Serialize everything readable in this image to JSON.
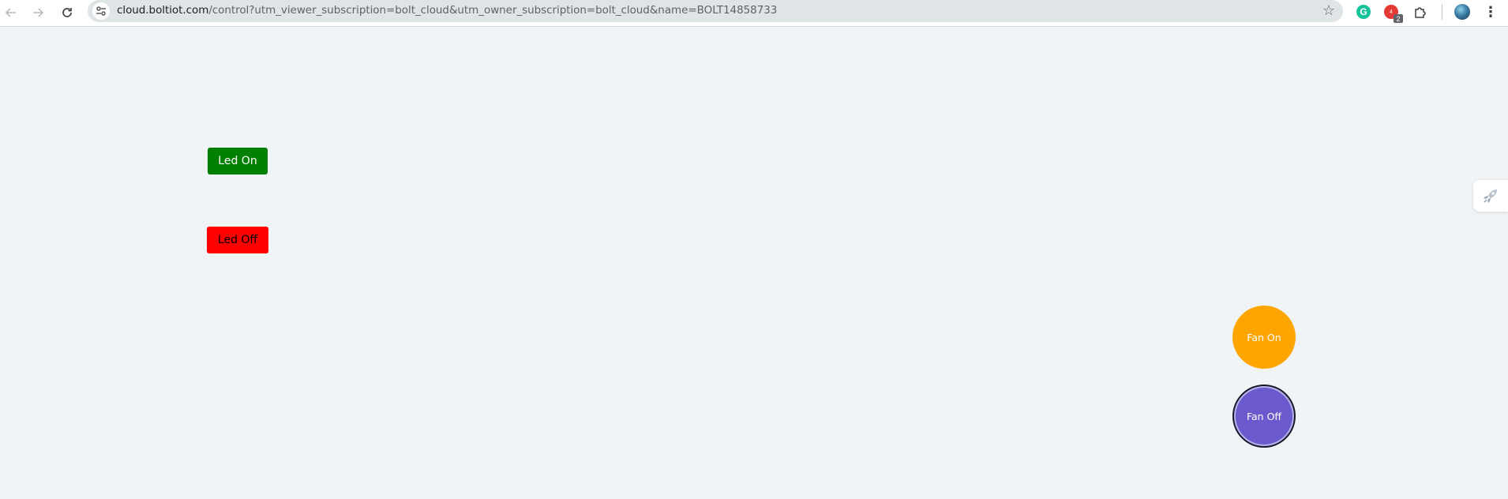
{
  "browser": {
    "back_icon": "arrow-left-icon",
    "forward_icon": "arrow-right-icon",
    "reload_icon": "reload-icon",
    "url_host": "cloud.boltiot.com",
    "url_path": "/control?utm_viewer_subscription=bolt_cloud&utm_owner_subscription=bolt_cloud&name=BOLT14858733",
    "extension_badge_count": "2",
    "extension_badge_label": "4",
    "grammarly_letter": "G"
  },
  "controls": {
    "led_on_label": "Led On",
    "led_off_label": "Led Off",
    "fan_on_label": "Fan On",
    "fan_off_label": "Fan Off"
  },
  "colors": {
    "led_on": "#008000",
    "led_off": "#ff0000",
    "fan_on": "#ffa500",
    "fan_off": "#6a5acd",
    "page_background": "#f1f4f7"
  }
}
